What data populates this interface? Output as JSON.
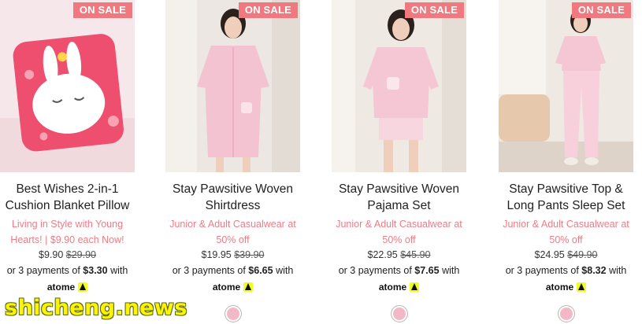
{
  "products": [
    {
      "badge": "ON SALE",
      "title_line1": "Best Wishes 2-in-1",
      "title_line2": "Cushion Blanket Pillow",
      "subtitle_line1": "Living in Style with Young",
      "subtitle_line2": "Hearts! | $9.90 each Now!",
      "price": "$9.90",
      "was_price": "$29.90",
      "installment_prefix": "or 3 payments of",
      "installment_amount": "$3.30",
      "installment_suffix": "with",
      "payment_brand": "atome",
      "has_swatch": false
    },
    {
      "badge": "ON SALE",
      "title_line1": "Stay Pawsitive Woven",
      "title_line2": "Shirtdress",
      "subtitle_line1": "Junior & Adult Casualwear at",
      "subtitle_line2": "50% off",
      "price": "$19.95",
      "was_price": "$39.90",
      "installment_prefix": "or 3 payments of",
      "installment_amount": "$6.65",
      "installment_suffix": "with",
      "payment_brand": "atome",
      "has_swatch": true
    },
    {
      "badge": "ON SALE",
      "title_line1": "Stay Pawsitive Woven",
      "title_line2": "Pajama Set",
      "subtitle_line1": "Junior & Adult Casualwear at",
      "subtitle_line2": "50% off",
      "price": "$22.95",
      "was_price": "$45.90",
      "installment_prefix": "or 3 payments of",
      "installment_amount": "$7.65",
      "installment_suffix": "with",
      "payment_brand": "atome",
      "has_swatch": true
    },
    {
      "badge": "ON SALE",
      "title_line1": "Stay Pawsitive Top &",
      "title_line2": "Long Pants Sleep Set",
      "subtitle_line1": "Junior & Adult Casualwear at",
      "subtitle_line2": "50% off",
      "price": "$24.95",
      "was_price": "$49.90",
      "installment_prefix": "or 3 payments of",
      "installment_amount": "$8.32",
      "installment_suffix": "with",
      "payment_brand": "atome",
      "has_swatch": true
    }
  ],
  "colors": {
    "sale_badge": "#f0787f",
    "subtitle": "#ee7c86",
    "swatch_pink": "#f3b8c8",
    "atome_accent": "#f0ff1f"
  },
  "watermark": "shicheng.news"
}
